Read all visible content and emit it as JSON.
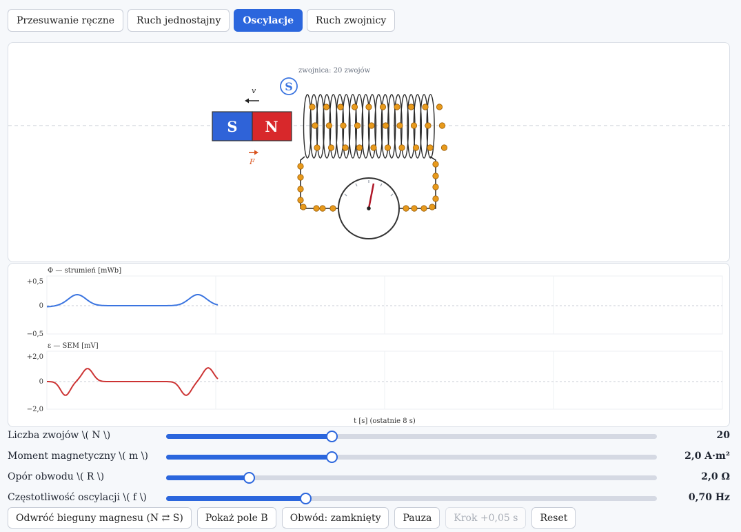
{
  "tabs": [
    "Przesuwanie ręczne",
    "Ruch jednostajny",
    "Oscylacje",
    "Ruch zwojnicy"
  ],
  "active_tab": 2,
  "sim": {
    "coil_label": "zwojnica: 20 zwojów",
    "s_badge": "S",
    "velocity_label": "v",
    "force_label": "F",
    "magnet_left_pole": "S",
    "magnet_right_pole": "N",
    "colors": {
      "pole_s": "#2f63d8",
      "pole_n": "#d8282b",
      "electron": "#e89a1c",
      "needle": "#b0192a",
      "force": "#d9531e"
    }
  },
  "graphs": {
    "flux": {
      "label": "Φ — strumień [mWb]",
      "ticks": [
        "+0,5",
        "0",
        "−0,5"
      ]
    },
    "emf": {
      "label": "ε — SEM [mV]",
      "ticks": [
        "+2,0",
        "0",
        "−2,0"
      ]
    },
    "xlabel": "t [s] (ostatnie 8 s)",
    "colors": {
      "flux": "#3a74e0",
      "emf": "#cc3333"
    }
  },
  "sliders": [
    {
      "label": "Liczba zwojów \\( N \\)",
      "value_text": "20",
      "fraction": 0.337
    },
    {
      "label": "Moment magnetyczny \\( m \\)",
      "value_text": "2,0 A·m²",
      "fraction": 0.337
    },
    {
      "label": "Opór obwodu \\( R \\)",
      "value_text": "2,0 Ω",
      "fraction": 0.168
    },
    {
      "label": "Częstotliwość oscylacji \\( f \\)",
      "value_text": "0,70 Hz",
      "fraction": 0.284
    }
  ],
  "actions": {
    "flip": "Odwróć bieguny magnesu (N ⇄ S)",
    "show_field": "Pokaż pole B",
    "circuit": "Obwód: zamknięty",
    "pause": "Pauza",
    "step": "Krok +0,05 s",
    "reset": "Reset"
  }
}
